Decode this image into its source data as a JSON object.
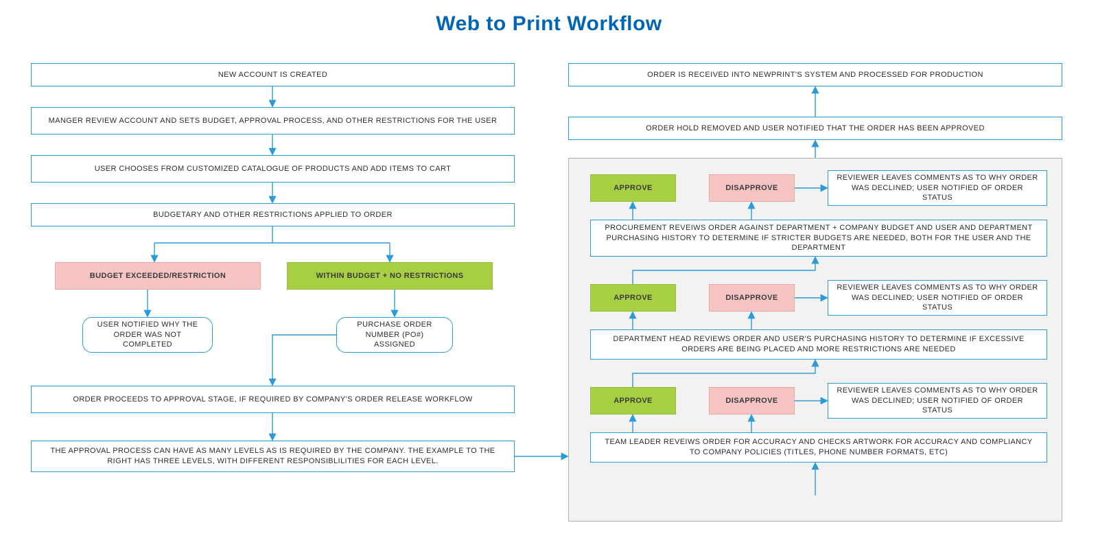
{
  "title": "Web to Print Workflow",
  "left": {
    "new_account": "NEW ACCOUNT IS CREATED",
    "manager_review": "MANGER REVIEW ACCOUNT AND SETS BUDGET, APPROVAL PROCESS, AND OTHER RESTRICTIONS FOR THE USER",
    "user_chooses": "USER CHOOSES FROM CUSTOMIZED CATALOGUE OF PRODUCTS AND ADD ITEMS TO CART",
    "budgetary": "BUDGETARY AND OTHER RESTRICTIONS APPLIED TO ORDER",
    "budget_exceeded": "BUDGET EXCEEDED/RESTRICTION",
    "within_budget": "WITHIN BUDGET + NO RESTRICTIONS",
    "user_notified": "USER NOTIFIED WHY THE ORDER WAS NOT COMPLETED",
    "po_assigned": "PURCHASE ORDER NUMBER (PO#) ASSIGNED",
    "order_proceeds": "ORDER PROCEEDS TO APPROVAL STAGE, IF REQUIRED BY COMPANY'S ORDER RELEASE WORKFLOW",
    "approval_process": "THE APPROVAL PROCESS CAN HAVE AS MANY LEVELS AS IS REQUIRED BY THE COMPANY. THE EXAMPLE TO THE RIGHT HAS THREE LEVELS, WITH DIFFERENT RESPONSIBLILITIES FOR EACH LEVEL."
  },
  "right": {
    "order_received": "ORDER IS RECEIVED INTO NEWPRINT'S SYSTEM AND PROCESSED FOR PRODUCTION",
    "order_hold_removed": "ORDER HOLD REMOVED AND USER NOTIFIED THAT THE ORDER HAS BEEN APPROVED",
    "approve": "APPROVE",
    "disapprove": "DISAPPROVE",
    "reviewer_comments": "REVIEWER LEAVES COMMENTS AS TO WHY ORDER WAS DECLINED; USER NOTIFIED OF ORDER STATUS",
    "procurement": "PROCUREMENT REVEIWS ORDER AGAINST DEPARTMENT + COMPANY BUDGET AND USER AND DEPARTMENT PURCHASING HISTORY TO DETERMINE IF STRICTER BUDGETS ARE NEEDED, BOTH FOR THE USER AND THE DEPARTMENT",
    "department_head": "DEPARTMENT HEAD REVIEWS ORDER AND USER'S PURCHASING HISTORY TO DETERMINE IF EXCESSIVE ORDERS ARE BEING PLACED AND MORE RESTRICTIONS ARE NEEDED",
    "team_leader": "TEAM LEADER REVEIWS ORDER FOR ACCURACY AND CHECKS ARTWORK FOR ACCURACY AND COMPLIANCY TO COMPANY POLICIES (TITLES, PHONE NUMBER FORMATS, ETC)"
  },
  "colors": {
    "blue": "#0066b3",
    "border": "#2a9bd6",
    "red": "#f6c4c2",
    "green": "#a7cf44"
  }
}
